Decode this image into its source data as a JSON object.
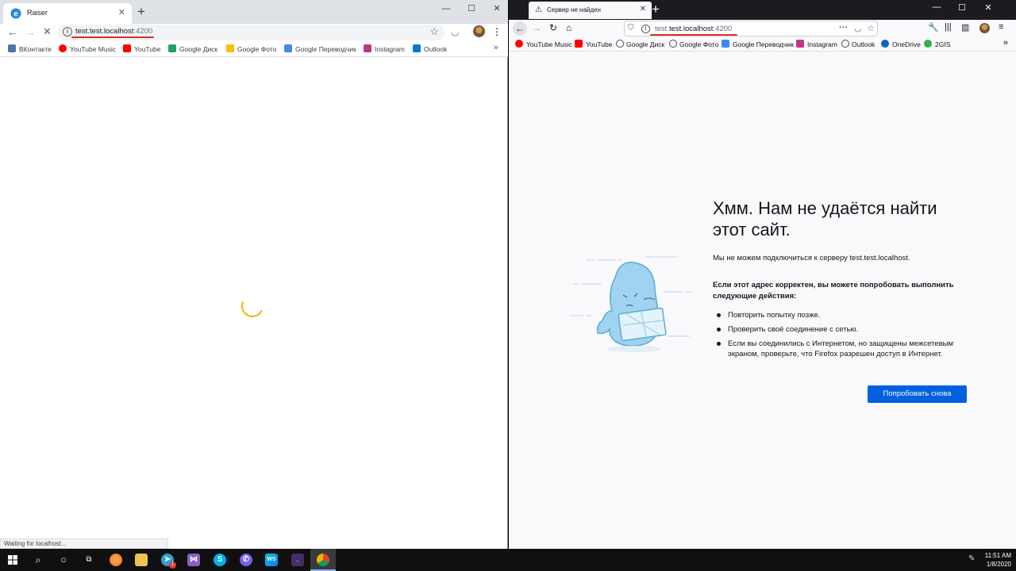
{
  "chrome": {
    "tab_title": "Raiser",
    "url_host": "test.test.localhost",
    "url_port": ":4200",
    "bookmarks": [
      {
        "label": "ВКонтакте",
        "color": "#4a76a8"
      },
      {
        "label": "YouTube Music",
        "color": "#ff0000"
      },
      {
        "label": "YouTube",
        "color": "#ff0000"
      },
      {
        "label": "Google Диск",
        "color": "#1fa463"
      },
      {
        "label": "Google Фото",
        "color": "#fbbc04"
      },
      {
        "label": "Google Переводчик",
        "color": "#4285f4"
      },
      {
        "label": "Instagram",
        "color": "#c13584"
      },
      {
        "label": "Outlook",
        "color": "#0078d4"
      }
    ],
    "more_label": "»",
    "status_text": "Waiting for localhost..."
  },
  "firefox": {
    "tab_title": "Сервер не найден",
    "url_sub": "test.",
    "url_main": "test.localhost",
    "url_port": ":4200",
    "bookmarks": [
      {
        "label": "YouTube Music",
        "icon": "youtube-music-icon"
      },
      {
        "label": "YouTube",
        "icon": "youtube-icon"
      },
      {
        "label": "Google Диск",
        "icon": "globe-icon"
      },
      {
        "label": "Google Фото",
        "icon": "globe-icon"
      },
      {
        "label": "Google Переводчик",
        "icon": "google-translate-icon"
      },
      {
        "label": "Instagram",
        "icon": "instagram-icon"
      },
      {
        "label": "Outlook",
        "icon": "globe-icon"
      },
      {
        "label": "OneDrive",
        "icon": "onedrive-icon"
      },
      {
        "label": "2GIS",
        "icon": "2gis-icon"
      }
    ],
    "more_label": "»",
    "error": {
      "title": "Хмм. Нам не удаётся найти этот сайт.",
      "description": "Мы не можем подключиться к серверу test.test.localhost.",
      "advice_heading": "Если этот адрес корректен, вы можете попробовать выполнить следующие действия:",
      "advice_items": [
        "Повторить попытку позже.",
        "Проверить своё соединение с сетью.",
        "Если вы соединились с Интернетом, но защищены межсетевым экраном, проверьте, что Firefox разрешен доступ в Интернет."
      ],
      "retry_label": "Попробовать снова"
    }
  },
  "taskbar": {
    "time": "11:51 AM",
    "date": "1/8/2020",
    "badge_count": "1"
  },
  "colors": {
    "firefox_button": "#0061e0",
    "spinner": "#f4b400",
    "url_underline": "#d93025"
  }
}
